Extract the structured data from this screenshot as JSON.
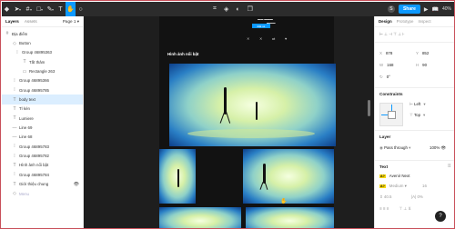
{
  "toolbar": {
    "menu_icon": "figma-menu-icon",
    "tools": [
      "move-tool",
      "frame-tool",
      "shape-tool",
      "pen-tool",
      "text-tool",
      "hand-tool",
      "comment-tool"
    ],
    "active_tool": "hand-tool",
    "avatar_initial": "S",
    "share_label": "Share",
    "zoom_label": "40%"
  },
  "left_panel": {
    "tab_layers": "Layers",
    "tab_assets": "Assets",
    "page_selector": "Page 1",
    "layers": [
      {
        "label": "Địa điểm",
        "icon": "frame-icon"
      },
      {
        "label": "Button",
        "icon": "component-icon"
      },
      {
        "label": "Group 46895363",
        "icon": "group-icon"
      },
      {
        "label": "Tất thảm",
        "icon": "text-icon"
      },
      {
        "label": "Rectangle 263",
        "icon": "rectangle-icon"
      },
      {
        "label": "Group 46895366",
        "icon": "group-icon"
      },
      {
        "label": "Group 46895785",
        "icon": "group-icon"
      },
      {
        "label": "body text",
        "icon": "text-icon",
        "selected": true
      },
      {
        "label": "Tỉ kèn",
        "icon": "text-icon"
      },
      {
        "label": "Lumiere",
        "icon": "text-icon"
      },
      {
        "label": "Line 69",
        "icon": "line-icon"
      },
      {
        "label": "Line 68",
        "icon": "line-icon"
      },
      {
        "label": "Group 46895783",
        "icon": "group-icon"
      },
      {
        "label": "Group 46895782",
        "icon": "group-icon"
      },
      {
        "label": "Hình ảnh nổi bật",
        "icon": "text-icon"
      },
      {
        "label": "Group 46895784",
        "icon": "group-icon"
      },
      {
        "label": "Giới thiệu chung",
        "icon": "text-icon"
      },
      {
        "label": "Menu",
        "icon": "component-icon",
        "dim": true
      }
    ]
  },
  "canvas": {
    "mini_button": "Đặt vé",
    "section_heading": "Hình ảnh nổi bật"
  },
  "right_panel": {
    "tab_design": "Design",
    "tab_prototype": "Prototype",
    "tab_inspect": "Inspect",
    "x_label": "X",
    "x_value": "878",
    "y_label": "Y",
    "y_value": "852",
    "w_label": "W",
    "w_value": "168",
    "h_label": "H",
    "h_value": "90",
    "rotation_label": "↻",
    "rotation_value": "0°",
    "constraints_title": "Constraints",
    "constraint_h": "Left",
    "constraint_v": "Top",
    "layer_title": "Layer",
    "blend_mode": "Pass through",
    "opacity": "100%",
    "text_title": "Text",
    "font_family": "Avenir Next",
    "font_weight": "Medium",
    "font_size": "16",
    "line_height": "40.5",
    "letter_spacing": "0%",
    "badge_label": "A?"
  },
  "help_label": "?"
}
